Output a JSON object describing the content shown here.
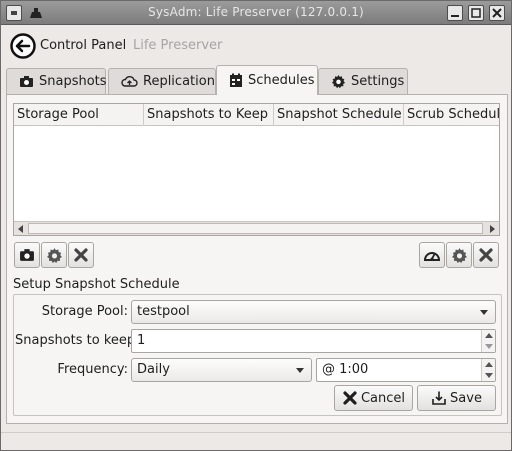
{
  "window": {
    "title": "SysAdm: Life Preserver (127.0.0.1)"
  },
  "nav": {
    "control_panel": "Control Panel",
    "current": "Life Preserver"
  },
  "tabs": [
    {
      "label": "Snapshots",
      "icon": "camera-icon"
    },
    {
      "label": "Replication",
      "icon": "cloud-upload-icon"
    },
    {
      "label": "Schedules",
      "icon": "calendar-icon",
      "active": true
    },
    {
      "label": "Settings",
      "icon": "gear-icon"
    }
  ],
  "table": {
    "columns": [
      "Storage Pool",
      "Snapshots to Keep",
      "Snapshot Schedule",
      "Scrub Schedule"
    ],
    "rows": []
  },
  "section": {
    "title": "Setup Snapshot Schedule"
  },
  "form": {
    "storage_pool_label": "Storage Pool:",
    "storage_pool_value": "testpool",
    "keep_label": "Snapshots to keep:",
    "keep_value": "1",
    "frequency_label": "Frequency:",
    "frequency_value": "Daily",
    "time_value": "@ 1:00"
  },
  "buttons": {
    "cancel": "Cancel",
    "save": "Save"
  },
  "colors": {
    "accent_red": "#3c3c3c",
    "title_bar": "#8a8a8a"
  }
}
